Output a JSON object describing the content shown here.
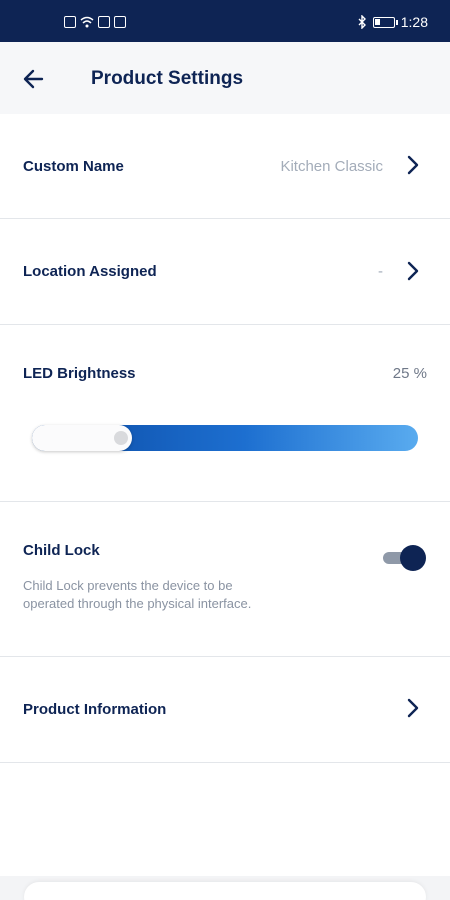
{
  "status_bar": {
    "time": "1:28",
    "icons": [
      "notification-icon",
      "wifi-icon",
      "mail-icon",
      "gallery-icon",
      "bluetooth-icon",
      "battery-icon"
    ]
  },
  "header": {
    "title": "Product Settings",
    "back_icon": "arrow-left-icon"
  },
  "settings": {
    "custom_name": {
      "label": "Custom Name",
      "value": "Kitchen Classic"
    },
    "location": {
      "label": "Location Assigned",
      "value": "-"
    },
    "led": {
      "label": "LED Brightness",
      "value_text": "25 %",
      "level_percent": 25
    },
    "child_lock": {
      "label": "Child Lock",
      "description": "Child Lock prevents the device to be operated through the physical interface.",
      "enabled": true
    },
    "product_info": {
      "label": "Product Information"
    }
  },
  "colors": {
    "navy": "#0e2454",
    "slider_start": "#0b4aa3",
    "slider_end": "#59abef",
    "muted_text": "#a3acb9"
  }
}
